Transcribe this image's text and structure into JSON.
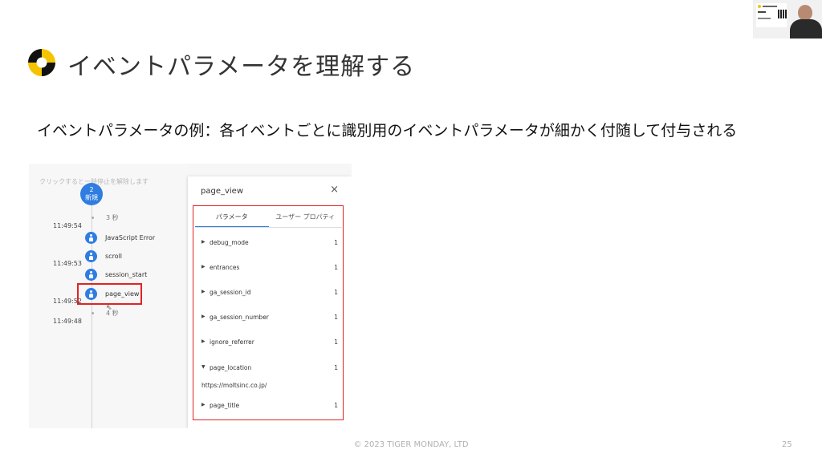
{
  "slide": {
    "title": "イベントパラメータを理解する",
    "subtitle": "イベントパラメータの例：各イベントごとに識別用のイベントパラメータが細かく付随して付与される",
    "footer": "© 2023 TIGER MONDAY, LTD",
    "page_number": "25",
    "logo_icon": "tiger-monday-logo-icon",
    "colors": {
      "logo_yellow": "#f5c400",
      "logo_black": "#111111",
      "highlight_red": "#e02424",
      "accent_blue": "#2f7de1"
    }
  },
  "timeline": {
    "hint": "クリックするとー時停止を解除します",
    "badge": {
      "count": "2",
      "label": "新規"
    },
    "gaps": [
      "3 秒",
      "4 秒"
    ],
    "times": [
      "11:49:54",
      "11:49:53",
      "11:49:52",
      "11:49:48"
    ],
    "events": [
      {
        "label": "JavaScript Error"
      },
      {
        "label": "scroll"
      },
      {
        "label": "session_start"
      },
      {
        "label": "page_view"
      }
    ]
  },
  "panel": {
    "title": "page_view",
    "close": "×",
    "tabs": [
      {
        "label": "パラメータ",
        "active": true
      },
      {
        "label": "ユーザー プロパティ",
        "active": false
      }
    ],
    "params": [
      {
        "name": "debug_mode",
        "value": "1",
        "expanded": false
      },
      {
        "name": "entrances",
        "value": "1",
        "expanded": false
      },
      {
        "name": "ga_session_id",
        "value": "1",
        "expanded": false
      },
      {
        "name": "ga_session_number",
        "value": "1",
        "expanded": false
      },
      {
        "name": "ignore_referrer",
        "value": "1",
        "expanded": false
      },
      {
        "name": "page_location",
        "value": "1",
        "expanded": true,
        "detail": "https://moltsinc.co.jp/"
      },
      {
        "name": "page_title",
        "value": "1",
        "expanded": false
      }
    ]
  }
}
